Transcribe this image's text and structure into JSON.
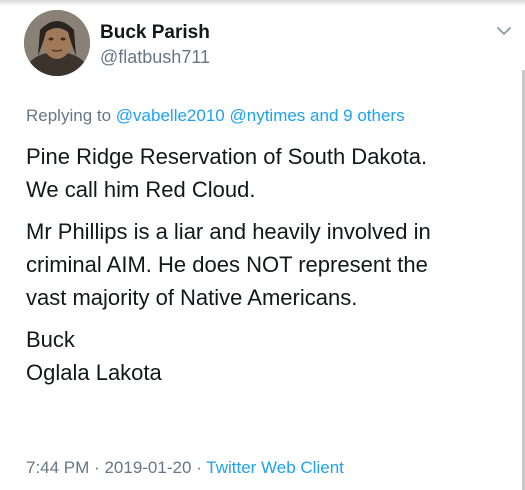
{
  "tweet": {
    "author": {
      "display_name": "Buck Parish",
      "handle": "@flatbush711",
      "avatar_icon": "portrait-avatar"
    },
    "menu_icon": "chevron-down-icon",
    "reply": {
      "prefix": "Replying to",
      "mention_1": "@vabelle2010",
      "mention_2": "@nytimes",
      "and_text": "and",
      "others": "9 others"
    },
    "paragraphs": [
      [
        "Pine Ridge Reservation of South Dakota.",
        "We call him Red Cloud."
      ],
      [
        "Mr Phillips is a liar and heavily involved in",
        "criminal AIM. He does NOT represent the",
        "vast majority of Native Americans."
      ],
      [
        "Buck",
        "Oglala Lakota"
      ]
    ],
    "meta": {
      "time": "7:44 PM",
      "separator": "·",
      "date": "2019-01-20",
      "client": "Twitter Web Client"
    }
  },
  "colors": {
    "text": "#14171a",
    "secondary": "#657786",
    "link": "#1da1f2"
  }
}
